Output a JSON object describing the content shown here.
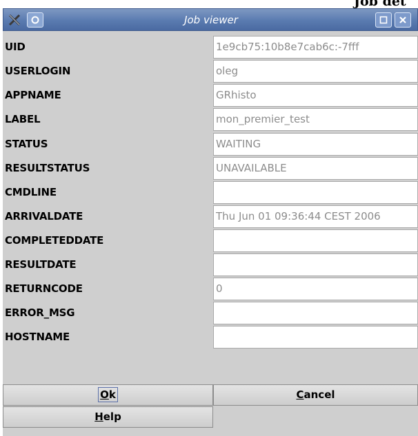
{
  "background_title": "Job det",
  "window": {
    "title": "Job viewer",
    "icons": {
      "left": "close-icon",
      "menu": "window-menu-icon",
      "maximize": "maximize-icon",
      "close": "close-icon"
    }
  },
  "fields": [
    {
      "label": "UID",
      "value": "1e9cb75:10b8e7cab6c:-7fff"
    },
    {
      "label": "USERLOGIN",
      "value": "oleg"
    },
    {
      "label": "APPNAME",
      "value": "GRhisto"
    },
    {
      "label": "LABEL",
      "value": "mon_premier_test"
    },
    {
      "label": "STATUS",
      "value": "WAITING"
    },
    {
      "label": "RESULTSTATUS",
      "value": "UNAVAILABLE"
    },
    {
      "label": "CMDLINE",
      "value": ""
    },
    {
      "label": "ARRIVALDATE",
      "value": "Thu Jun 01 09:36:44 CEST 2006"
    },
    {
      "label": "COMPLETEDDATE",
      "value": ""
    },
    {
      "label": "RESULTDATE",
      "value": ""
    },
    {
      "label": "RETURNCODE",
      "value": "0"
    },
    {
      "label": "ERROR_MSG",
      "value": ""
    },
    {
      "label": "HOSTNAME",
      "value": ""
    }
  ],
  "buttons": {
    "ok": {
      "mnemonic": "O",
      "rest": "k"
    },
    "cancel": {
      "mnemonic": "C",
      "rest": "ancel"
    },
    "help": {
      "mnemonic": "H",
      "rest": "elp"
    }
  },
  "colors": {
    "titlebar": "#5a7bb0",
    "panel": "#cfcfcf",
    "field_text": "#8c8c8c"
  }
}
